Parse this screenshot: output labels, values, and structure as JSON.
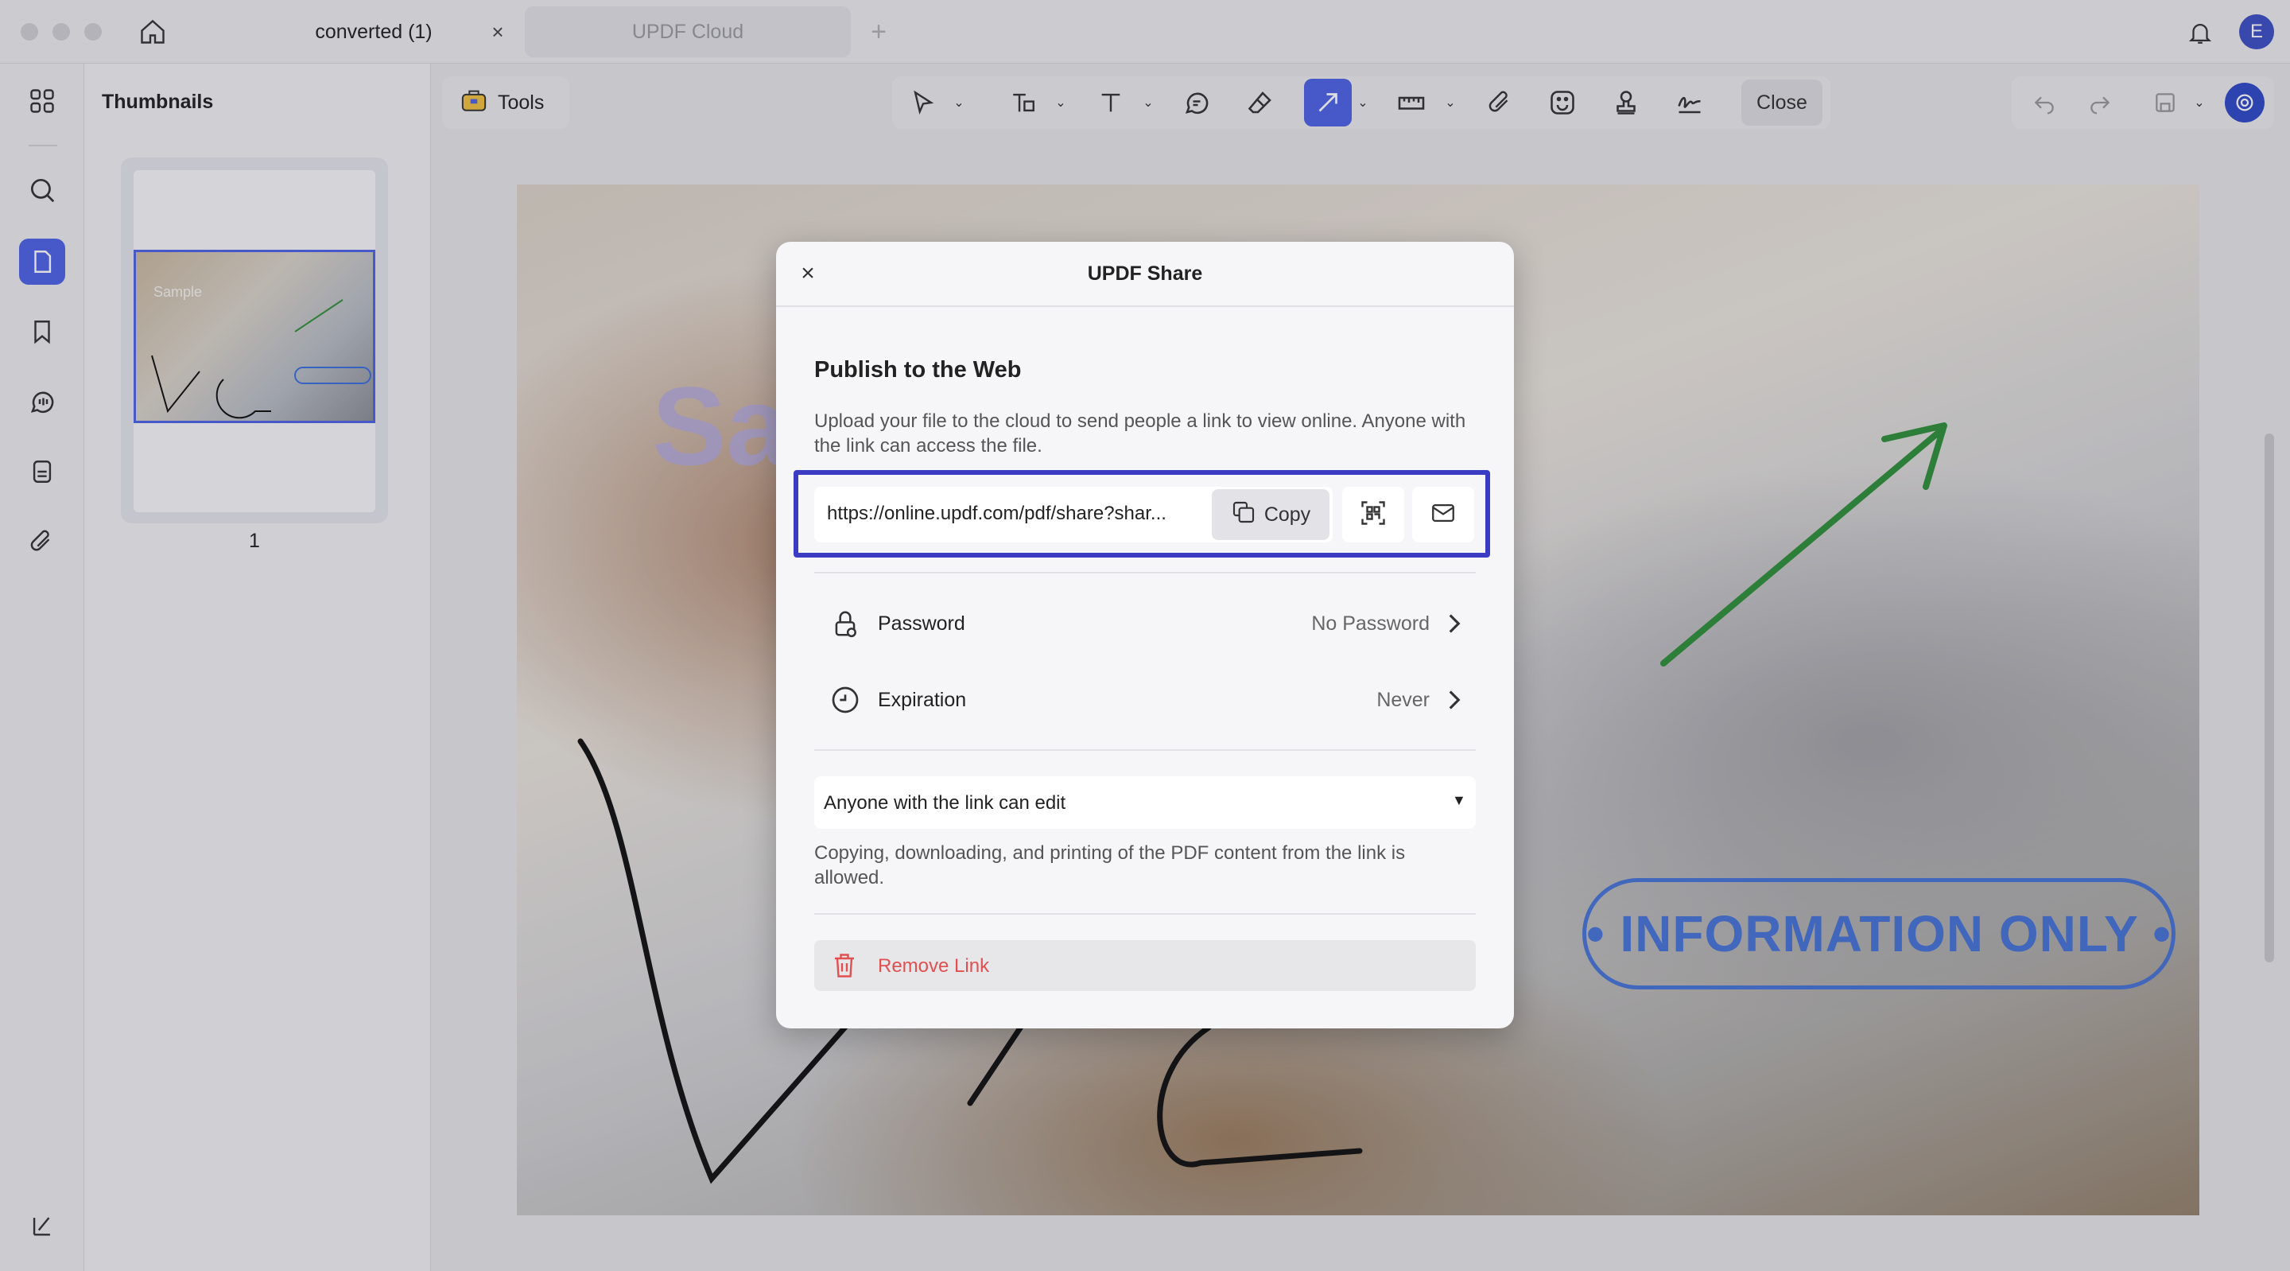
{
  "window": {
    "tabs": [
      {
        "label": "converted (1)",
        "active": true
      },
      {
        "label": "UPDF Cloud",
        "active": false
      }
    ],
    "avatar_initial": "E"
  },
  "thumbnails": {
    "title": "Thumbnails",
    "page_number": "1",
    "thumb_sample_text": "Sample"
  },
  "toolbar": {
    "tools_label": "Tools",
    "close_label": "Close"
  },
  "document": {
    "sample_text": "Sa",
    "stamp_text": "• INFORMATION ONLY •"
  },
  "share_dialog": {
    "title": "UPDF Share",
    "section_title": "Publish to the Web",
    "description": "Upload your file to the cloud to send people a link to view online. Anyone with the link can access the file.",
    "link_url": "https://online.updf.com/pdf/share?shar...",
    "copy_label": "Copy",
    "password_label": "Password",
    "password_value": "No Password",
    "expiration_label": "Expiration",
    "expiration_value": "Never",
    "permission_value": "Anyone with the link can edit",
    "permission_desc": "Copying, downloading, and printing of the PDF content from the link is allowed.",
    "remove_label": "Remove Link"
  },
  "colors": {
    "accent": "#4e62e6",
    "highlight_frame": "#3b3bc4",
    "danger": "#e05050",
    "arrow": "#2f8f3a"
  }
}
